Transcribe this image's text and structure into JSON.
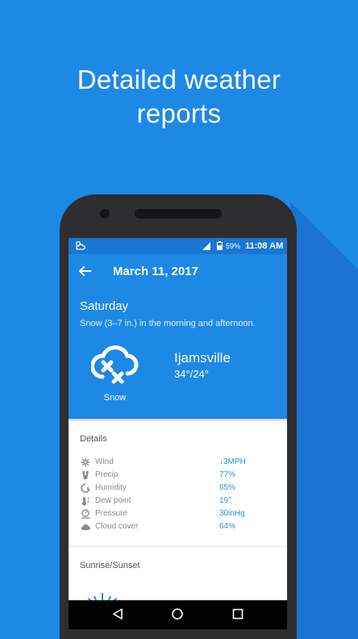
{
  "headline": {
    "line1": "Detailed weather",
    "line2": "reports"
  },
  "status_bar": {
    "battery": "59%",
    "time": "11:08 AM"
  },
  "app_bar": {
    "title": "March 11, 2017",
    "back_icon": "arrow-back-icon"
  },
  "forecast": {
    "day": "Saturday",
    "summary": "Snow (3–7 in.) in the morning and afternoon.",
    "condition": "Snow",
    "condition_icon": "snow-cloud-icon",
    "location": "Ijamsville",
    "temps": "34°/24°"
  },
  "details": {
    "title": "Details",
    "rows": [
      {
        "icon": "wind-icon",
        "label": "Wind",
        "value": "↓3MPH"
      },
      {
        "icon": "precip-icon",
        "label": "Precip",
        "value": "77%"
      },
      {
        "icon": "humidity-icon",
        "label": "Humidity",
        "value": "65%"
      },
      {
        "icon": "dew-point-icon",
        "label": "Dew point",
        "value": "19°"
      },
      {
        "icon": "pressure-icon",
        "label": "Pressure",
        "value": "30inHg"
      },
      {
        "icon": "cloud-cover-icon",
        "label": "Cloud cover",
        "value": "64%"
      }
    ]
  },
  "sunrise_sunset": {
    "title": "Sunrise/Sunset"
  },
  "colors": {
    "background": "#1E88E5",
    "status_bar": "#1976D2",
    "accent_value": "#2D8FE8"
  }
}
